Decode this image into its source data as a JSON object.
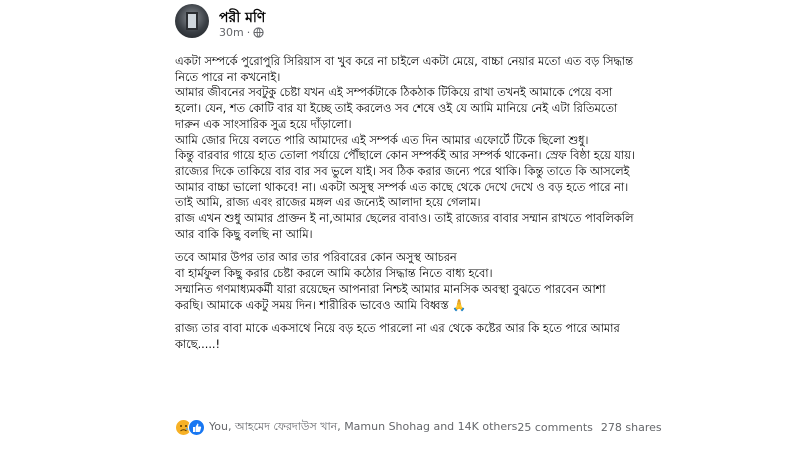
{
  "post": {
    "author": "পরী মণি",
    "time": "30m",
    "dot": "·",
    "paragraphs": [
      "একটা সম্পর্কে পুরোপুরি সিরিয়াস বা খুব করে না চাইলে একটা মেয়ে, বাচ্চা নেয়ার মতো এত বড় সিদ্ধান্ত নিতে পারে না কখনোই।",
      "আমার জীবনের সবটুকু চেষ্টা যখন এই সম্পর্কটাকে ঠিকঠাক টিকিয়ে রাখা তখনই আমাকে পেয়ে বসা হলো। যেন, শত কোটি বার যা ইচ্ছে তাই করলেও সব শেষে ওই যে আমি মানিয়ে নেই এটা রিতিমতো দারুন এক সাংসারিক সুত্র হয়ে দাঁড়ালো।",
      "আমি জোর দিয়ে বলতে পারি আমাদের এই সম্পর্ক এত দিন আমার এফোর্টে টিকে ছিলো শুধু।",
      "কিন্তু বারবার গায়ে হাত তোলা পর্যায়ে পৌঁছালে কোন সম্পর্কই আর সম্পর্ক থাকেনা। স্রেফ বিষ্ঠা হয়ে যায়।",
      "রাজ্যের দিকে তাকিয়ে বার বার সব ভুলে যাই। সব ঠিক করার জন্যে পরে থাকি। কিন্তু তাতে কি আসলেই আমার বাচ্চা ভালো থাকবে! না। একটা অসুস্থ সম্পর্ক এত কাছে থেকে দেখে দেখে ও বড় হতে পারে না।",
      "তাই আমি, রাজ্য এবং রাজের মঙ্গল এর জন্যেই আলাদা হয়ে গেলাম।",
      "রাজ এখন শুধু আমার প্রাক্তন ই না,আমার ছেলের বাবাও। তাই রাজ্যের বাবার সম্মান রাখতে পাবলিকলি আর বাকি কিছু বলছি না আমি।",
      "তবে আমার উপর তার আর তার পরিবারের কোন অসুস্থ আচরন",
      "বা হার্মফুল কিছু করার চেষ্টা করলে আমি কঠোর সিদ্ধান্ত নিতে বাধ্য হবো।",
      "সম্মানিত গণমাধ্যমকর্মী যারা রয়েছেন আপনারা নিশ্চই আমার মানসিক অবস্থা বুঝতে পারবেন আশা করছি। আমাকে একটু সময় দিন। শারীরিক ভাবেও আমি বিধ্বস্ত 🙏",
      "রাজ্য তার বাবা মাকে একসাথে নিয়ে বড় হতে পারলো না এর থেকে কষ্টের আর কি হতে পারে আমার কাছে.....!"
    ]
  },
  "footer": {
    "reactors": "You, আহমেদ ফেরদাউস খান, Mamun Shohag and 14K others",
    "comments": "25 comments",
    "shares": "278 shares"
  }
}
